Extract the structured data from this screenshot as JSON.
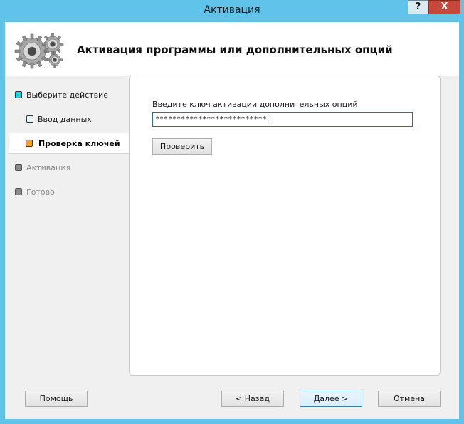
{
  "window": {
    "title": "Активация",
    "help_glyph": "?",
    "close_glyph": "X"
  },
  "header": {
    "title": "Активация программы или дополнительных опций"
  },
  "steps": [
    {
      "label": "Выберите действие",
      "color": "#20d0d8",
      "state": "done"
    },
    {
      "label": "Ввод данных",
      "color": "#e8f8fb",
      "state": "done"
    },
    {
      "label": "Проверка ключей",
      "color": "#f5a020",
      "state": "active"
    },
    {
      "label": "Активация",
      "color": "#8c8c8c",
      "state": "pending"
    },
    {
      "label": "Готово",
      "color": "#8c8c8c",
      "state": "pending"
    }
  ],
  "form": {
    "key_label": "Введите ключ активации дополнительных опций",
    "key_value": "**************************",
    "check_button": "Проверить"
  },
  "footer": {
    "help_button": "Помощь",
    "back_button": "< Назад",
    "next_button": "Далее >",
    "cancel_button": "Отмена"
  }
}
